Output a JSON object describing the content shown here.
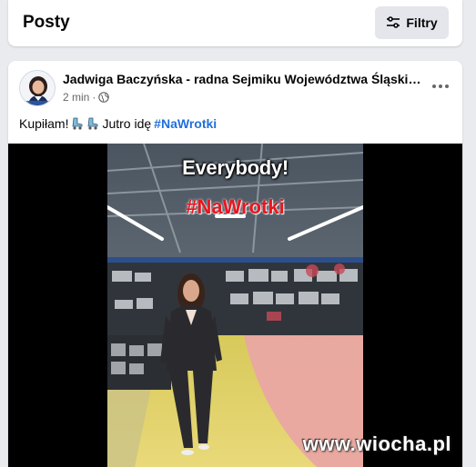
{
  "header": {
    "title": "Posty",
    "filter_label": "Filtry"
  },
  "post": {
    "author": "Jadwiga Baczyńska - radna Sejmiku Województwa Śląskiego",
    "time": "2 min",
    "time_separator": "·",
    "text_before": "Kupiłam!",
    "text_middle": "Jutro idę",
    "hashtag": "#NaWrotki",
    "video": {
      "caption_top": "Everybody!",
      "caption_hashtag": "#NaWrotki",
      "watermark": "www.wiocha.pl"
    }
  },
  "icons": {
    "filter": "sliders-icon",
    "privacy": "globe-icon",
    "more": "more-dots-icon",
    "emoji": "roller-skate-icon"
  },
  "colors": {
    "link": "#216fdb",
    "caption_hashtag": "#e8161f"
  }
}
